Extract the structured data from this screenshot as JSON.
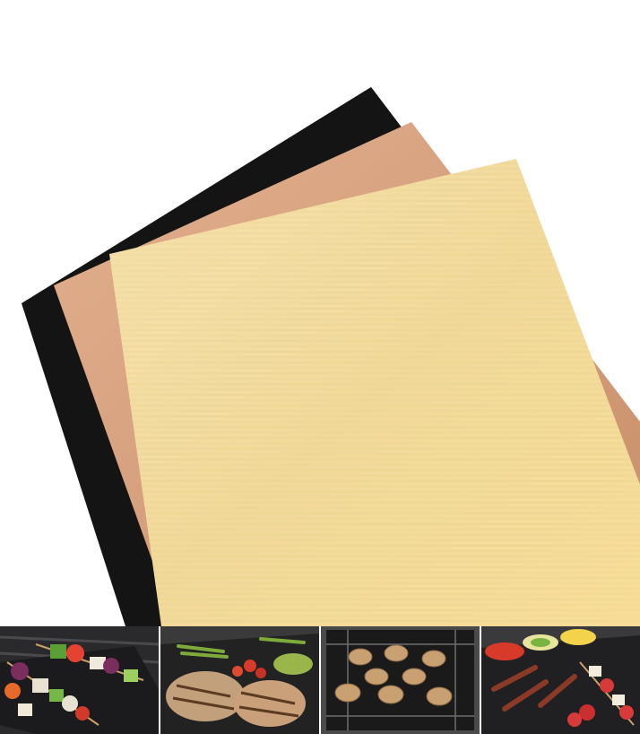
{
  "product": {
    "mats": [
      {
        "name": "black-mat",
        "color": "#141414"
      },
      {
        "name": "copper-mat",
        "color": "#d9a07e"
      },
      {
        "name": "cream-mat",
        "color": "#f2dca0"
      }
    ],
    "background_color": "#ffffff"
  },
  "thumbnails": [
    {
      "subject": "vegetable-skewers-on-grill-mat",
      "mat_color": "#1b1b1d"
    },
    {
      "subject": "grilled-meat-and-asparagus-on-grill-mat",
      "mat_color": "#222222"
    },
    {
      "subject": "patties-on-oven-rack-mat",
      "mat_color": "#1a1a1a"
    },
    {
      "subject": "bacon-and-strawberry-skewers-on-grill-mat",
      "mat_color": "#202022"
    }
  ]
}
